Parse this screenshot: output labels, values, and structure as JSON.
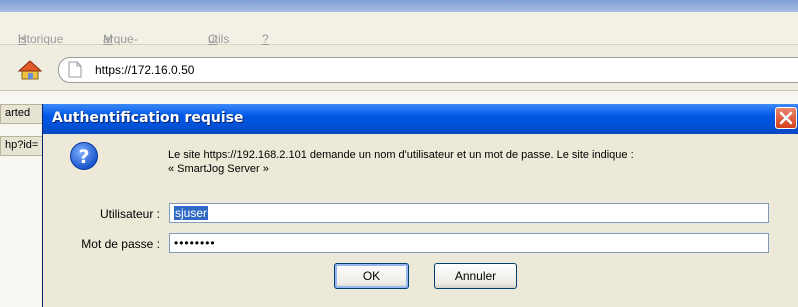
{
  "menubar": {
    "items": [
      {
        "first": "H",
        "rest": "istorique"
      },
      {
        "first": "M",
        "rest": "arque-pages"
      },
      {
        "first": "O",
        "rest": "utils"
      },
      {
        "first": "?",
        "rest": ""
      }
    ]
  },
  "navbar": {
    "url": "https://172.16.0.50"
  },
  "background": {
    "tab_fragment_1": "arted",
    "tab_fragment_2": "hp?id="
  },
  "dialog": {
    "title": "Authentification requise",
    "message_line1": "Le site https://192.168.2.101 demande un nom d'utilisateur et un mot de passe. Le site indique :",
    "message_line2": "« SmartJog Server »",
    "username_label": "Utilisateur :",
    "username_value": "sjuser",
    "password_label": "Mot de passe :",
    "password_value": "••••••••",
    "ok_label": "OK",
    "cancel_label": "Annuler"
  },
  "colors": {
    "titlebar": "#0058e6",
    "close": "#d6401d",
    "selection": "#316ac5"
  }
}
